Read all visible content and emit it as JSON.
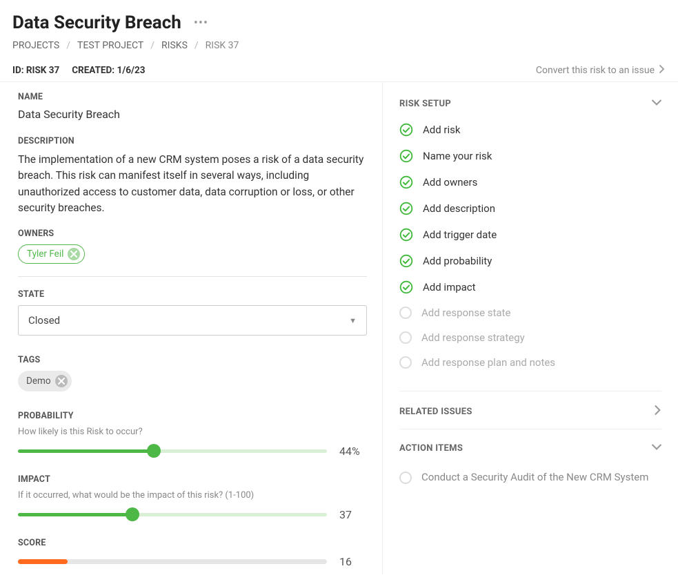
{
  "title": "Data Security Breach",
  "breadcrumb": [
    "PROJECTS",
    "TEST PROJECT",
    "RISKS",
    "RISK 37"
  ],
  "meta": {
    "id_label": "ID: RISK 37",
    "created_label": "CREATED: 1/6/23",
    "convert_label": "Convert this risk to an issue"
  },
  "fields": {
    "name_label": "NAME",
    "name_value": "Data Security Breach",
    "description_label": "DESCRIPTION",
    "description_value": "The implementation of a new CRM system poses a risk of a data security breach. This risk can manifest itself in several ways, including unauthorized access to customer data, data corruption or loss, or other security breaches.",
    "owners_label": "OWNERS",
    "owners": [
      "Tyler Feil"
    ],
    "state_label": "STATE",
    "state_value": "Closed",
    "tags_label": "TAGS",
    "tags": [
      "Demo"
    ],
    "probability_label": "PROBABILITY",
    "probability_sub": "How likely is this Risk to occur?",
    "probability_value": "44%",
    "probability_pct": 44,
    "impact_label": "IMPACT",
    "impact_sub": "If it occurred, what would be the impact of this risk? (1-100)",
    "impact_value": "37",
    "impact_pct": 37,
    "score_label": "SCORE",
    "score_value": "16",
    "score_pct": 16
  },
  "right": {
    "risk_setup_label": "RISK SETUP",
    "setup_items": [
      {
        "label": "Add risk",
        "done": true
      },
      {
        "label": "Name your risk",
        "done": true
      },
      {
        "label": "Add owners",
        "done": true
      },
      {
        "label": "Add description",
        "done": true
      },
      {
        "label": "Add trigger date",
        "done": true
      },
      {
        "label": "Add probability",
        "done": true
      },
      {
        "label": "Add impact",
        "done": true
      },
      {
        "label": "Add response state",
        "done": false
      },
      {
        "label": "Add response strategy",
        "done": false
      },
      {
        "label": "Add response plan and notes",
        "done": false
      }
    ],
    "related_issues_label": "RELATED ISSUES",
    "action_items_label": "ACTION ITEMS",
    "action_items": [
      "Conduct a Security Audit of the New CRM System"
    ]
  }
}
